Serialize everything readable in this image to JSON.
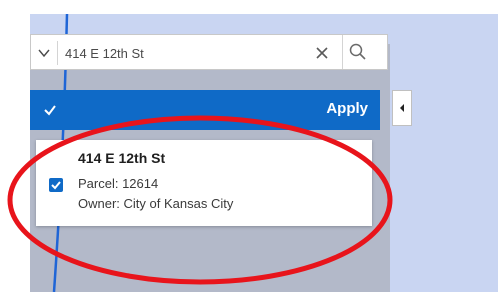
{
  "search": {
    "value": "414 E 12th St"
  },
  "results_header": {
    "apply_label": "Apply",
    "select_all_checked": true
  },
  "results": [
    {
      "title": "414 E 12th St",
      "parcel_line": "Parcel: 12614",
      "owner_line": "Owner: City of Kansas City",
      "checked": true
    }
  ],
  "icons": {
    "caret": "caret-down-icon",
    "clear": "close-icon",
    "search": "search-icon",
    "collapse": "chevron-left-icon",
    "checkbox": "checkbox-checked-icon"
  },
  "colors": {
    "accent": "#0f6ac7",
    "highlight_ellipse": "#e8141b",
    "map_land": "#b3b9c9",
    "map_water": "#c9d5f2",
    "road": "#1f65d6"
  }
}
